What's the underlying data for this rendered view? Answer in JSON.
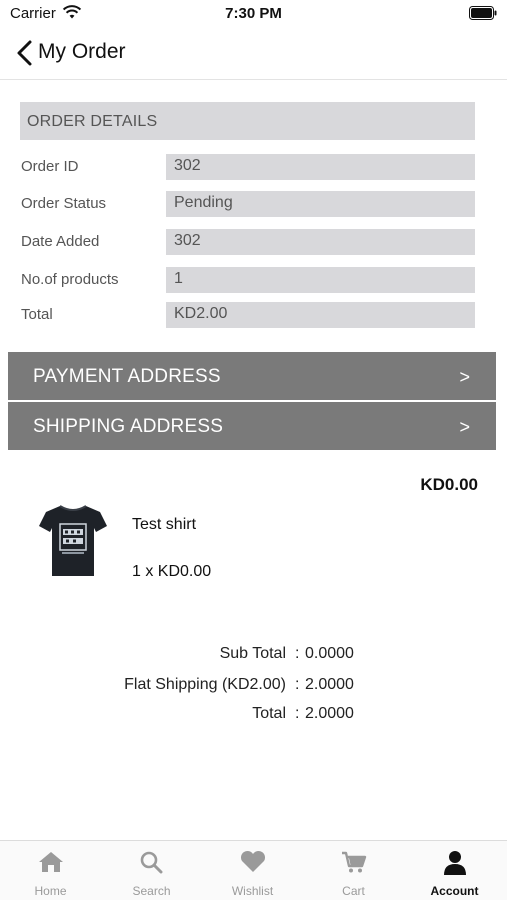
{
  "status_bar": {
    "carrier": "Carrier",
    "time": "7:30 PM"
  },
  "nav": {
    "title": "My Order"
  },
  "order_details": {
    "header": "ORDER DETAILS",
    "rows": [
      {
        "label": "Order ID",
        "value": "302"
      },
      {
        "label": "Order Status",
        "value": "Pending"
      },
      {
        "label": "Date Added",
        "value": "302"
      },
      {
        "label": "No.of products",
        "value": "1"
      },
      {
        "label": "Total",
        "value": "KD2.00"
      }
    ]
  },
  "payment_address": {
    "label": "PAYMENT ADDRESS",
    "chevron": ">"
  },
  "shipping_address": {
    "label": "SHIPPING ADDRESS",
    "chevron": ">"
  },
  "product": {
    "price": "KD0.00",
    "name": "Test shirt",
    "quantity": "1 x KD0.00",
    "image_icon": "tshirt-image"
  },
  "totals": [
    {
      "label": "Sub Total",
      "sep": ":",
      "value": "0.0000"
    },
    {
      "label": "Flat Shipping (KD2.00)",
      "sep": ":",
      "value": "2.0000"
    },
    {
      "label": "Total",
      "sep": ":",
      "value": "2.0000"
    }
  ],
  "tab_bar": {
    "items": [
      {
        "label": "Home",
        "icon": "home-icon"
      },
      {
        "label": "Search",
        "icon": "search-icon"
      },
      {
        "label": "Wishlist",
        "icon": "heart-icon"
      },
      {
        "label": "Cart",
        "icon": "cart-icon"
      },
      {
        "label": "Account",
        "icon": "account-icon",
        "active": true
      }
    ]
  },
  "colors": {
    "field_bg": "#d8d8db",
    "address_bar_bg": "#7a7a7a",
    "tab_inactive": "#9a9a9a",
    "tab_active": "#111111"
  }
}
